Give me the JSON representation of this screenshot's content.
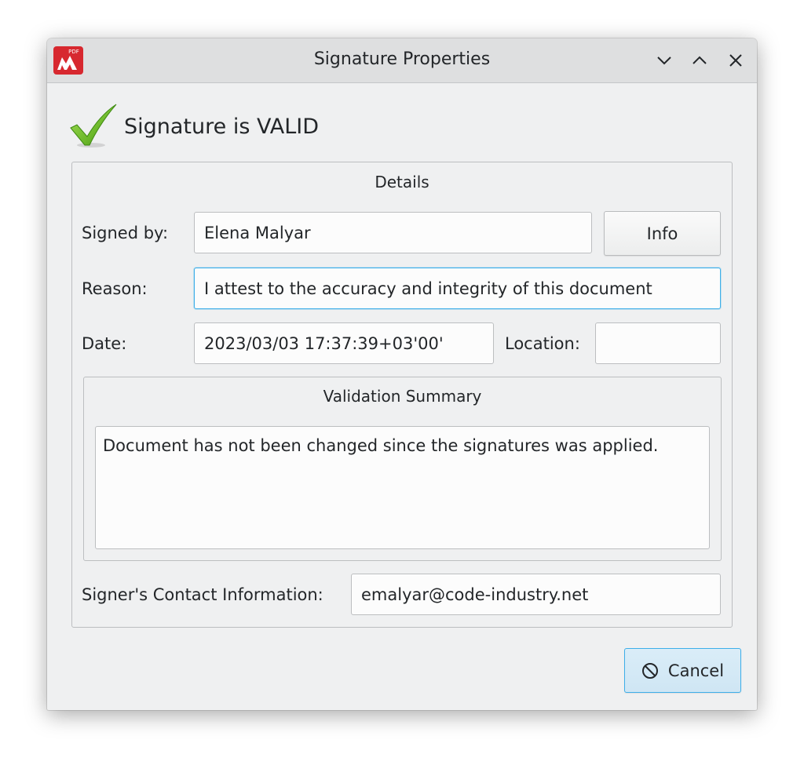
{
  "window": {
    "title": "Signature Properties",
    "app_icon_label": "PDF",
    "controls": [
      "minimize",
      "maximize",
      "close"
    ]
  },
  "status": {
    "text": "Signature is VALID",
    "icon": "check-icon",
    "color": "#6cb82a"
  },
  "details": {
    "title": "Details",
    "signed_by_label": "Signed by:",
    "signed_by_value": "Elena Malyar",
    "info_button": "Info",
    "reason_label": "Reason:",
    "reason_value": "I attest to the accuracy and integrity of this document",
    "date_label": "Date:",
    "date_value": "2023/03/03 17:37:39+03'00'",
    "location_label": "Location:",
    "location_value": ""
  },
  "validation": {
    "title": "Validation Summary",
    "text": "Document has not been changed since the signatures was applied."
  },
  "contact": {
    "label": "Signer's Contact Information:",
    "value": "emalyar@code-industry.net"
  },
  "footer": {
    "cancel_label": "Cancel",
    "cancel_icon": "cancel-icon"
  },
  "colors": {
    "accent": "#3daee9",
    "app_icon_red": "#d7282f",
    "dialog_bg": "#eff0f1"
  }
}
